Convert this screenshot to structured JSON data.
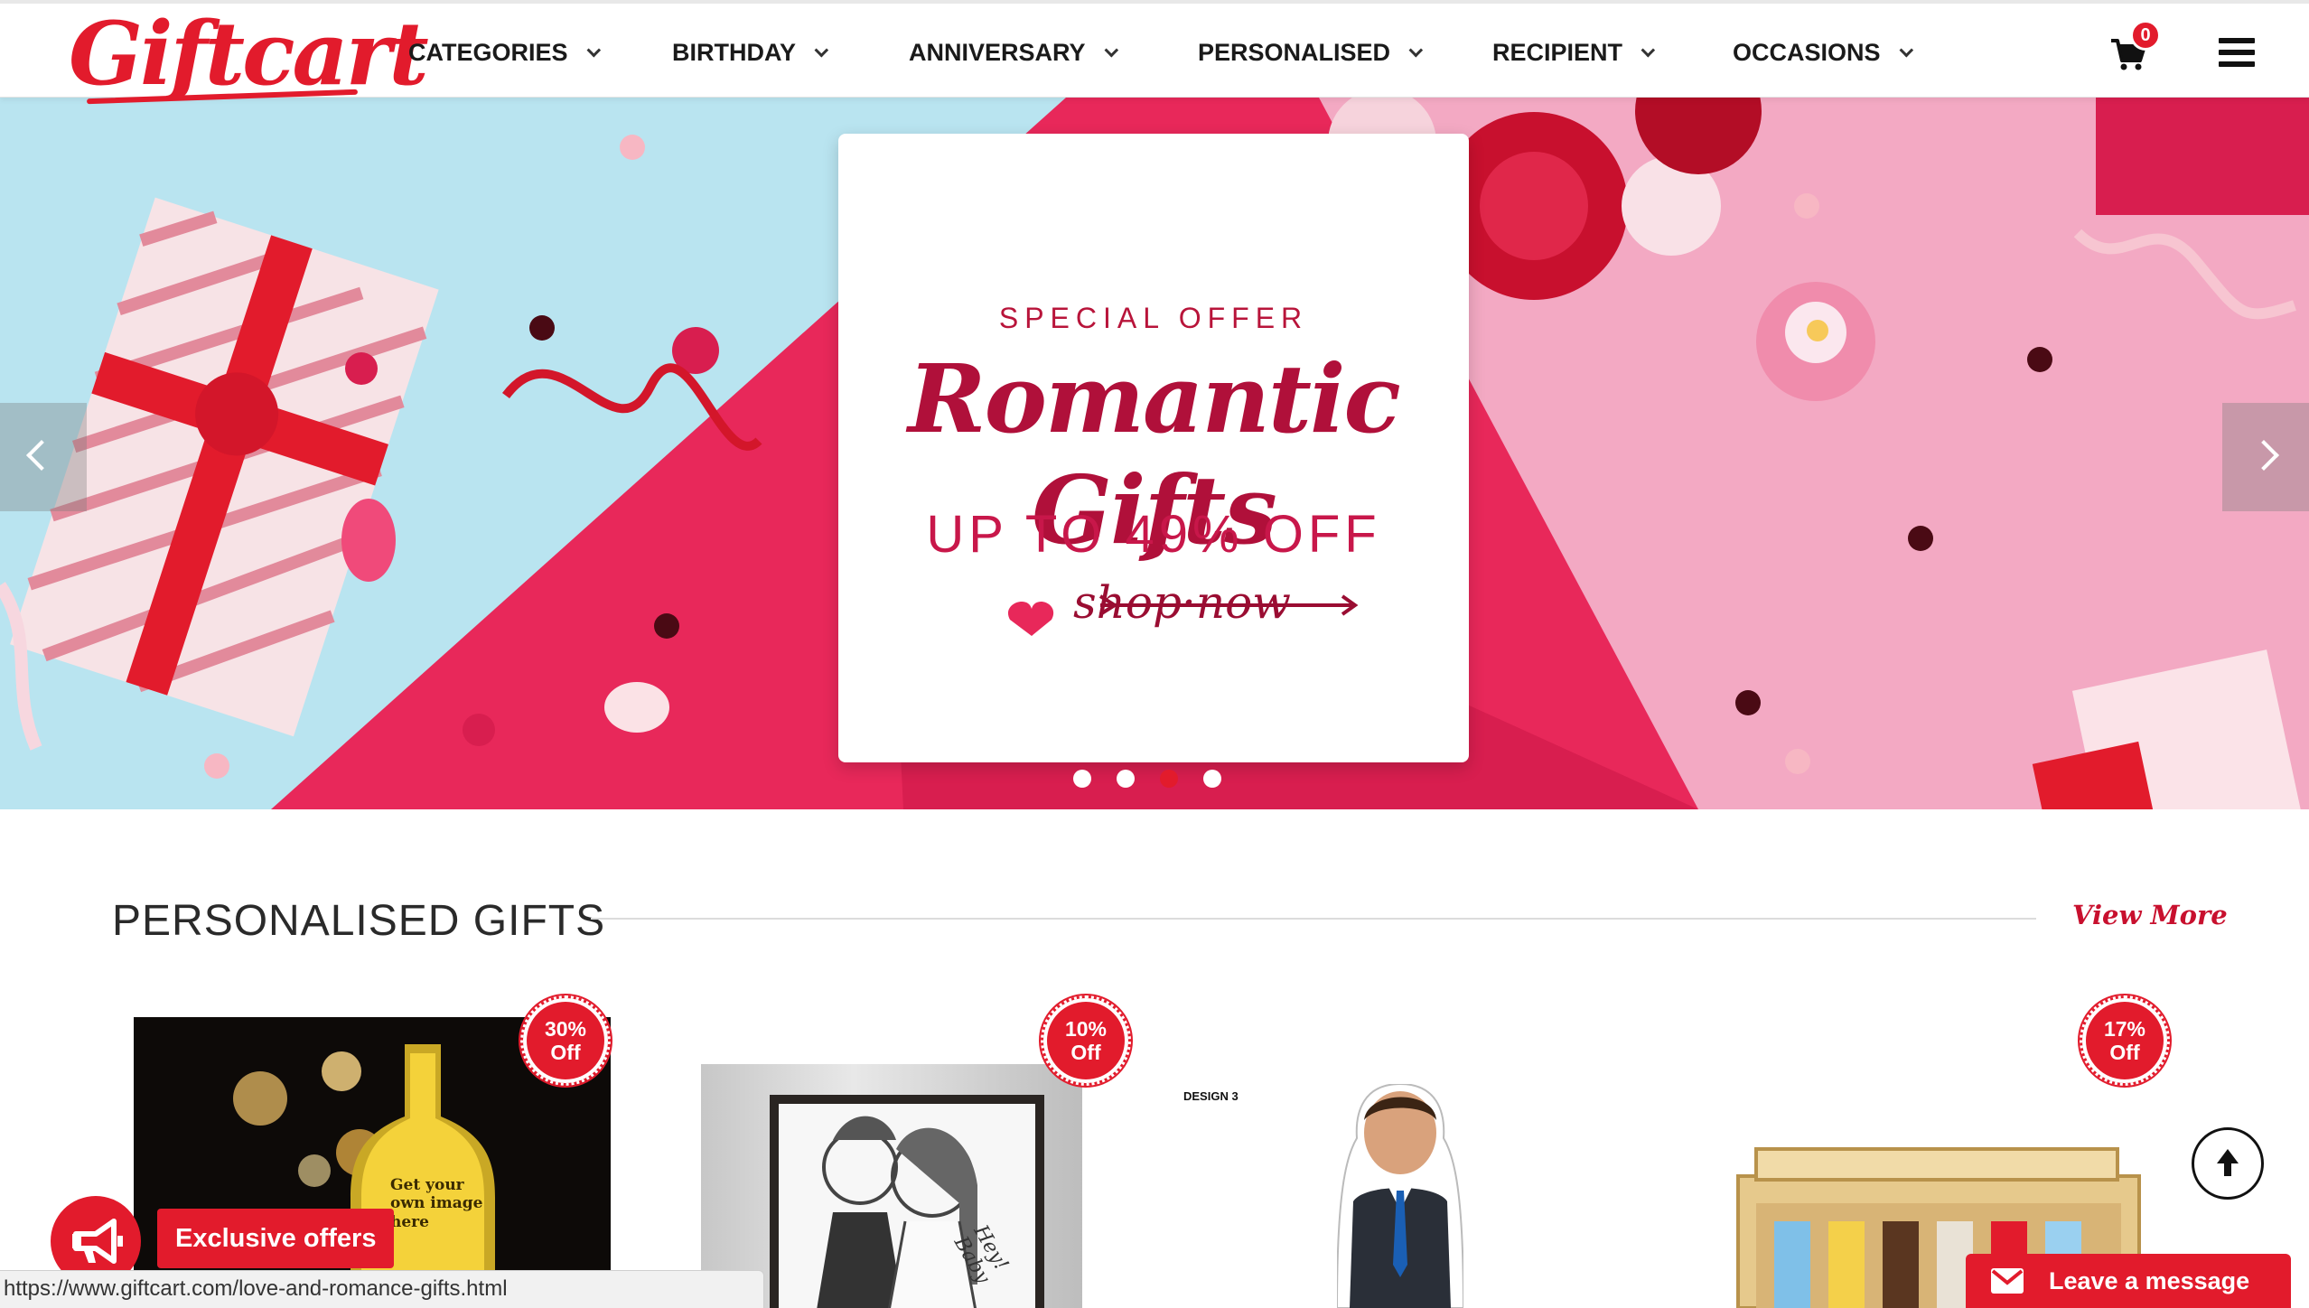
{
  "brand": {
    "logo_text": "Giftcart"
  },
  "nav": {
    "items": [
      {
        "label": "CATEGORIES"
      },
      {
        "label": "BIRTHDAY"
      },
      {
        "label": "ANNIVERSARY"
      },
      {
        "label": "PERSONALISED"
      },
      {
        "label": "RECIPIENT"
      },
      {
        "label": "OCCASIONS"
      }
    ],
    "cart_count": "0",
    "cart_icon": "shopping-cart-icon",
    "menu_icon": "hamburger-menu-icon"
  },
  "banner": {
    "offer_kicker": "SPECIAL OFFER",
    "offer_title": "Romantic Gifts",
    "offer_discount": "UP TO 49% OFF",
    "offer_cta": "shop·now",
    "slide_count": 4,
    "active_slide": 3,
    "prev_icon": "chevron-left-icon",
    "next_icon": "chevron-right-icon"
  },
  "section": {
    "title": "PERSONALISED GIFTS",
    "view_more": "View More"
  },
  "products": [
    {
      "badge_pct": "30%",
      "badge_off": "Off",
      "image_caption": "Get your own image here"
    },
    {
      "badge_pct": "10%",
      "badge_off": "Off",
      "image_caption": "Hey! Baby"
    },
    {
      "badge_pct": "",
      "badge_off": "",
      "image_caption": "DESIGN 3"
    },
    {
      "badge_pct": "17%",
      "badge_off": "Off",
      "image_caption": ""
    }
  ],
  "widgets": {
    "exclusive_offers": "Exclusive offers",
    "leave_message": "Leave a message",
    "status_url": "https://www.giftcart.com/love-and-romance-gifts.html"
  },
  "colors": {
    "brand_red": "#e21b2c",
    "banner_pink": "#f3a9c3",
    "banner_blue": "#b9e4f0",
    "banner_magenta": "#e8285a"
  }
}
